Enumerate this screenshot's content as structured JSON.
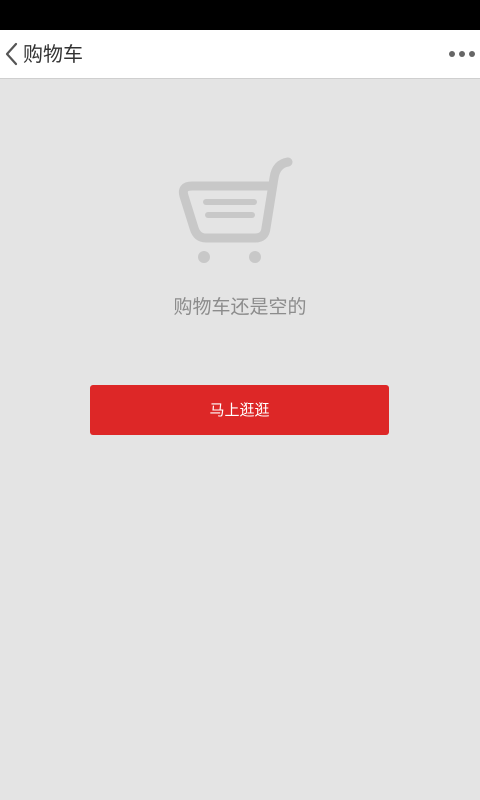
{
  "header": {
    "back_icon": "chevron-left-icon",
    "title": "购物车",
    "more_icon": "more-horizontal-icon"
  },
  "empty_state": {
    "icon": "shopping-cart-icon",
    "message": "购物车还是空的",
    "button_label": "马上逛逛"
  },
  "colors": {
    "status_bar": "#000000",
    "header_bg": "#ffffff",
    "page_bg": "#e4e4e4",
    "accent_button": "#dd2727",
    "icon_gray": "#c8c8c8",
    "muted_text": "#8c8c8c"
  }
}
